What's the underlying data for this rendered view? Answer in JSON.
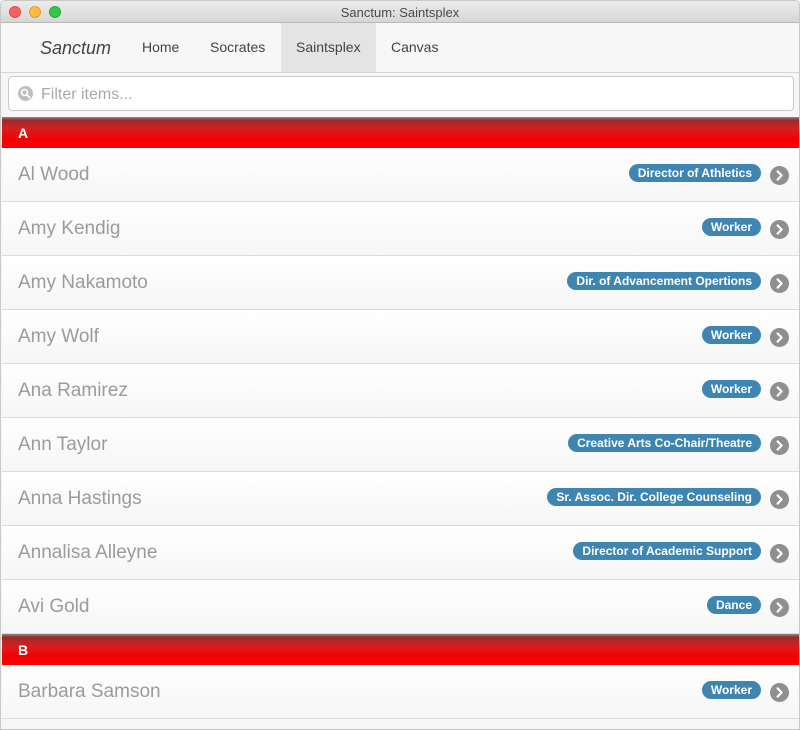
{
  "window": {
    "title": "Sanctum: Saintsplex"
  },
  "nav": {
    "brand": "Sanctum",
    "tabs": [
      "Home",
      "Socrates",
      "Saintsplex",
      "Canvas"
    ],
    "active_tab": "Saintsplex"
  },
  "filter": {
    "placeholder": "Filter items...",
    "value": ""
  },
  "colors": {
    "section_header": "#ff0000",
    "badge": "#3e86b1",
    "chevron": "#8f8f8f"
  },
  "icons": {
    "search": "search-icon",
    "row_disclosure": "chevron-right-circle-icon"
  },
  "sections": [
    {
      "letter": "A",
      "items": [
        {
          "name": "Al Wood",
          "role": "Director of Athletics"
        },
        {
          "name": "Amy Kendig",
          "role": "Worker"
        },
        {
          "name": "Amy Nakamoto",
          "role": "Dir. of Advancement Opertions"
        },
        {
          "name": "Amy Wolf",
          "role": "Worker"
        },
        {
          "name": "Ana Ramirez",
          "role": "Worker"
        },
        {
          "name": "Ann Taylor",
          "role": "Creative Arts Co-Chair/Theatre"
        },
        {
          "name": "Anna Hastings",
          "role": "Sr. Assoc. Dir. College Counseling"
        },
        {
          "name": "Annalisa Alleyne",
          "role": "Director of Academic Support"
        },
        {
          "name": "Avi Gold",
          "role": "Dance"
        }
      ]
    },
    {
      "letter": "B",
      "items": [
        {
          "name": "Barbara Samson",
          "role": "Worker"
        }
      ]
    }
  ]
}
